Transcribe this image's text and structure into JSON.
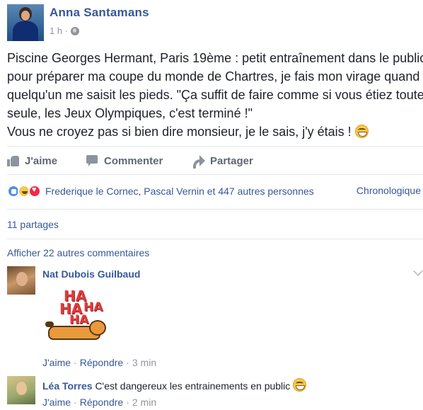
{
  "post": {
    "author": "Anna Santamans",
    "time": "1 h ·",
    "text_lines": [
      "Piscine Georges Hermant, Paris 19ème : petit entraînement dans le public",
      "pour préparer ma coupe du monde de Chartres, je fais mon virage quand",
      "quelqu'un me saisit les pieds. \"Ça suffit de faire comme si vous étiez toute",
      "seule, les Jeux Olympiques, c'est terminé !\"",
      "Vous ne croyez pas si bien dire monsieur, je le sais, j'y étais !"
    ]
  },
  "actions": {
    "like": "J'aime",
    "comment": "Commenter",
    "share": "Partager"
  },
  "reactions": {
    "summary": "Frederique le Cornec, Pascal Vernin et 447 autres personnes",
    "sort": "Chronologique"
  },
  "shares": "11 partages",
  "more_comments": "Afficher 22 autres commentaires",
  "comments": [
    {
      "author": "Nat Dubois Guilbaud",
      "text": "",
      "sticker_text": [
        "HA",
        "HA",
        "HA",
        "HA"
      ],
      "like": "J'aime",
      "reply": "Répondre",
      "time": "3 min"
    },
    {
      "author": "Léa Torres",
      "text": "C'est dangereux les entrainements en public",
      "like": "J'aime",
      "reply": "Répondre",
      "time": "2 min"
    }
  ],
  "colors": {
    "link": "#365899",
    "text": "#1d2129",
    "muted": "#90949c"
  }
}
